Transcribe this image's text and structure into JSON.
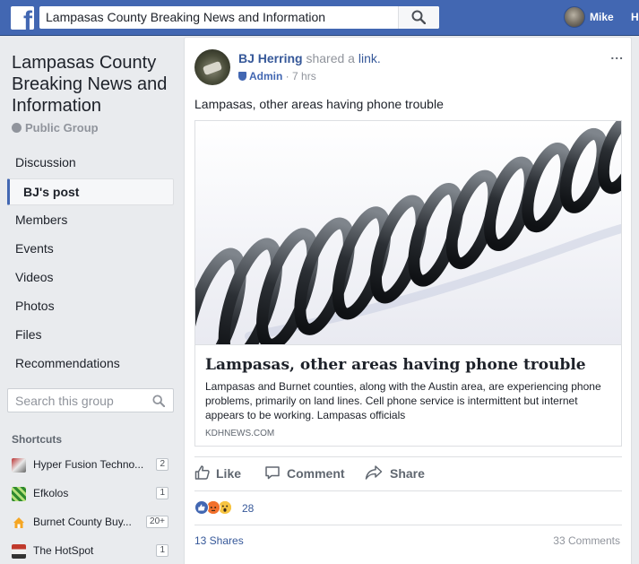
{
  "topbar": {
    "logo_letter": "f",
    "search_value": "Lampasas County Breaking News and Information",
    "user_name": "Mike",
    "user_extra": "H"
  },
  "sidebar": {
    "group_title": "Lampasas County Breaking News and Information",
    "privacy": "Public Group",
    "nav": [
      {
        "label": "Discussion",
        "active": false
      },
      {
        "label": "BJ's post",
        "active": true
      },
      {
        "label": "Members",
        "active": false
      },
      {
        "label": "Events",
        "active": false
      },
      {
        "label": "Videos",
        "active": false
      },
      {
        "label": "Photos",
        "active": false
      },
      {
        "label": "Files",
        "active": false
      },
      {
        "label": "Recommendations",
        "active": false
      }
    ],
    "search_placeholder": "Search this group",
    "shortcuts_header": "Shortcuts",
    "shortcuts": [
      {
        "name": "Hyper Fusion Techno...",
        "count": "2"
      },
      {
        "name": "Efkolos",
        "count": "1"
      },
      {
        "name": "Burnet County Buy...",
        "count": "20+"
      },
      {
        "name": "The HotSpot",
        "count": "1"
      }
    ]
  },
  "post": {
    "author": "BJ Herring",
    "verb": "shared a",
    "link_word": "link.",
    "role": "Admin",
    "time": "7 hrs",
    "more": "...",
    "text": "Lampasas, other areas having phone trouble",
    "link": {
      "title": "Lampasas, other areas having phone trouble",
      "description": "Lampasas and Burnet counties, along with the Austin area, are experiencing phone problems, primarily on land lines. Cell phone service is intermittent but internet appears to be working. Lampasas officials",
      "domain": "KDHNEWS.COM"
    },
    "actions": {
      "like": "Like",
      "comment": "Comment",
      "share": "Share"
    },
    "reactions_count": "28",
    "shares": "13 Shares",
    "comments": "33 Comments"
  },
  "colors": {
    "brand": "#4267b2",
    "link": "#365899",
    "muted": "#90949c"
  }
}
